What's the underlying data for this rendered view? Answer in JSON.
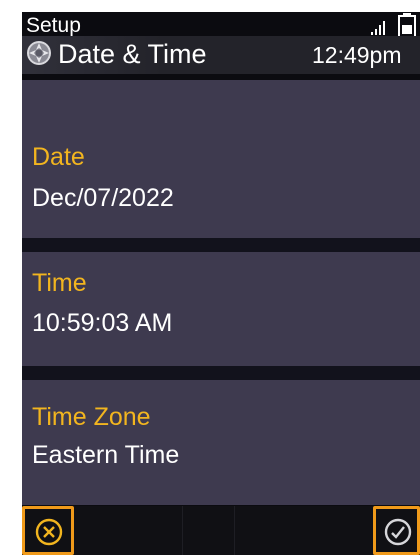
{
  "status_bar": {
    "app_label": "Setup",
    "signal_icon": "signal-bars-icon",
    "battery_icon": "battery-icon"
  },
  "header": {
    "icon": "settings-wheel-icon",
    "title": "Date & Time",
    "clock": "12:49pm"
  },
  "settings": [
    {
      "label": "Date",
      "value": "Dec/07/2022"
    },
    {
      "label": "Time",
      "value": "10:59:03 AM"
    },
    {
      "label": "Time Zone",
      "value": "Eastern Time"
    }
  ],
  "softkeys": {
    "cancel_icon": "cancel-x-icon",
    "confirm_icon": "confirm-check-icon"
  },
  "colors": {
    "label": "#f2b51f",
    "value": "#ffffff",
    "row_background": "#3e3a4f",
    "screen_background": "#0b0b10",
    "softkey_highlight": "#f09a1a"
  }
}
